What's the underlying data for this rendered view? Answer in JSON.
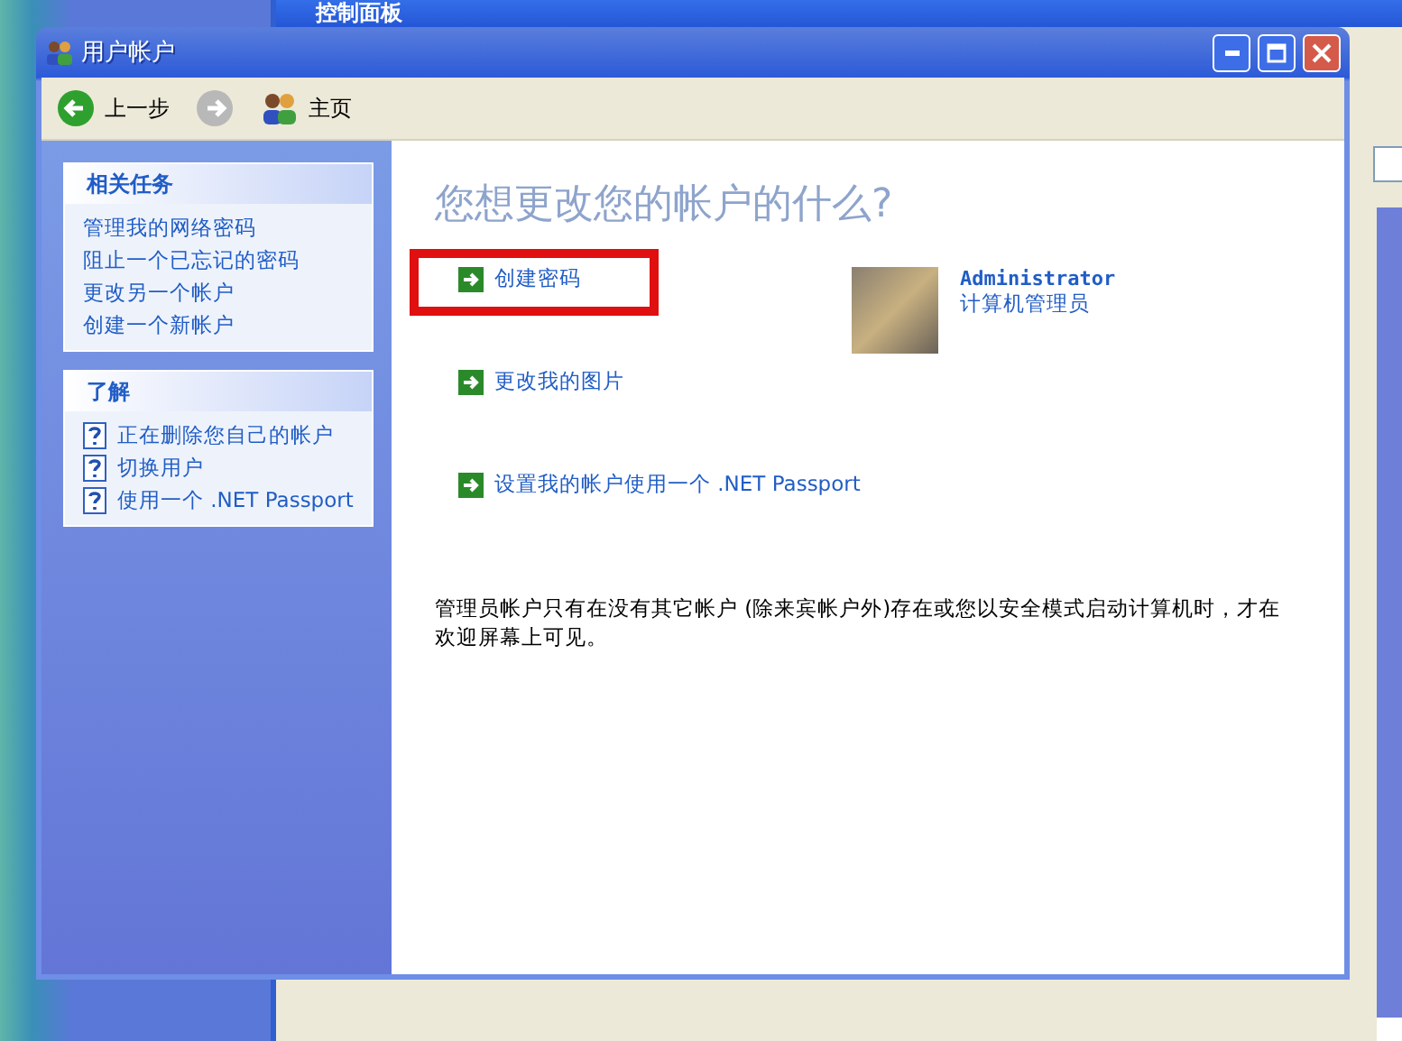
{
  "background_window": {
    "title": "控制面板"
  },
  "window": {
    "title": "用户帐户"
  },
  "toolbar": {
    "back": "上一步",
    "home": "主页"
  },
  "sidebar": {
    "panels": [
      {
        "title": "相关任务",
        "kind": "links",
        "items": [
          "管理我的网络密码",
          "阻止一个已忘记的密码",
          "更改另一个帐户",
          "创建一个新帐户"
        ]
      },
      {
        "title": "了解",
        "kind": "help",
        "items": [
          "正在删除您自己的帐户",
          "切换用户",
          "使用一个 .NET Passport"
        ]
      }
    ]
  },
  "content": {
    "heading": "您想更改您的帐户的什么?",
    "actions": [
      {
        "label": "创建密码",
        "highlighted": true
      },
      {
        "label": "更改我的图片",
        "highlighted": false
      },
      {
        "label": "设置我的帐户使用一个 .NET Passport",
        "highlighted": false
      }
    ],
    "account": {
      "name": "Administrator",
      "role": "计算机管理员"
    },
    "note": "管理员帐户只有在没有其它帐户 (除来宾帐户外)存在或您以安全模式启动计算机时，才在欢迎屏幕上可见。"
  }
}
